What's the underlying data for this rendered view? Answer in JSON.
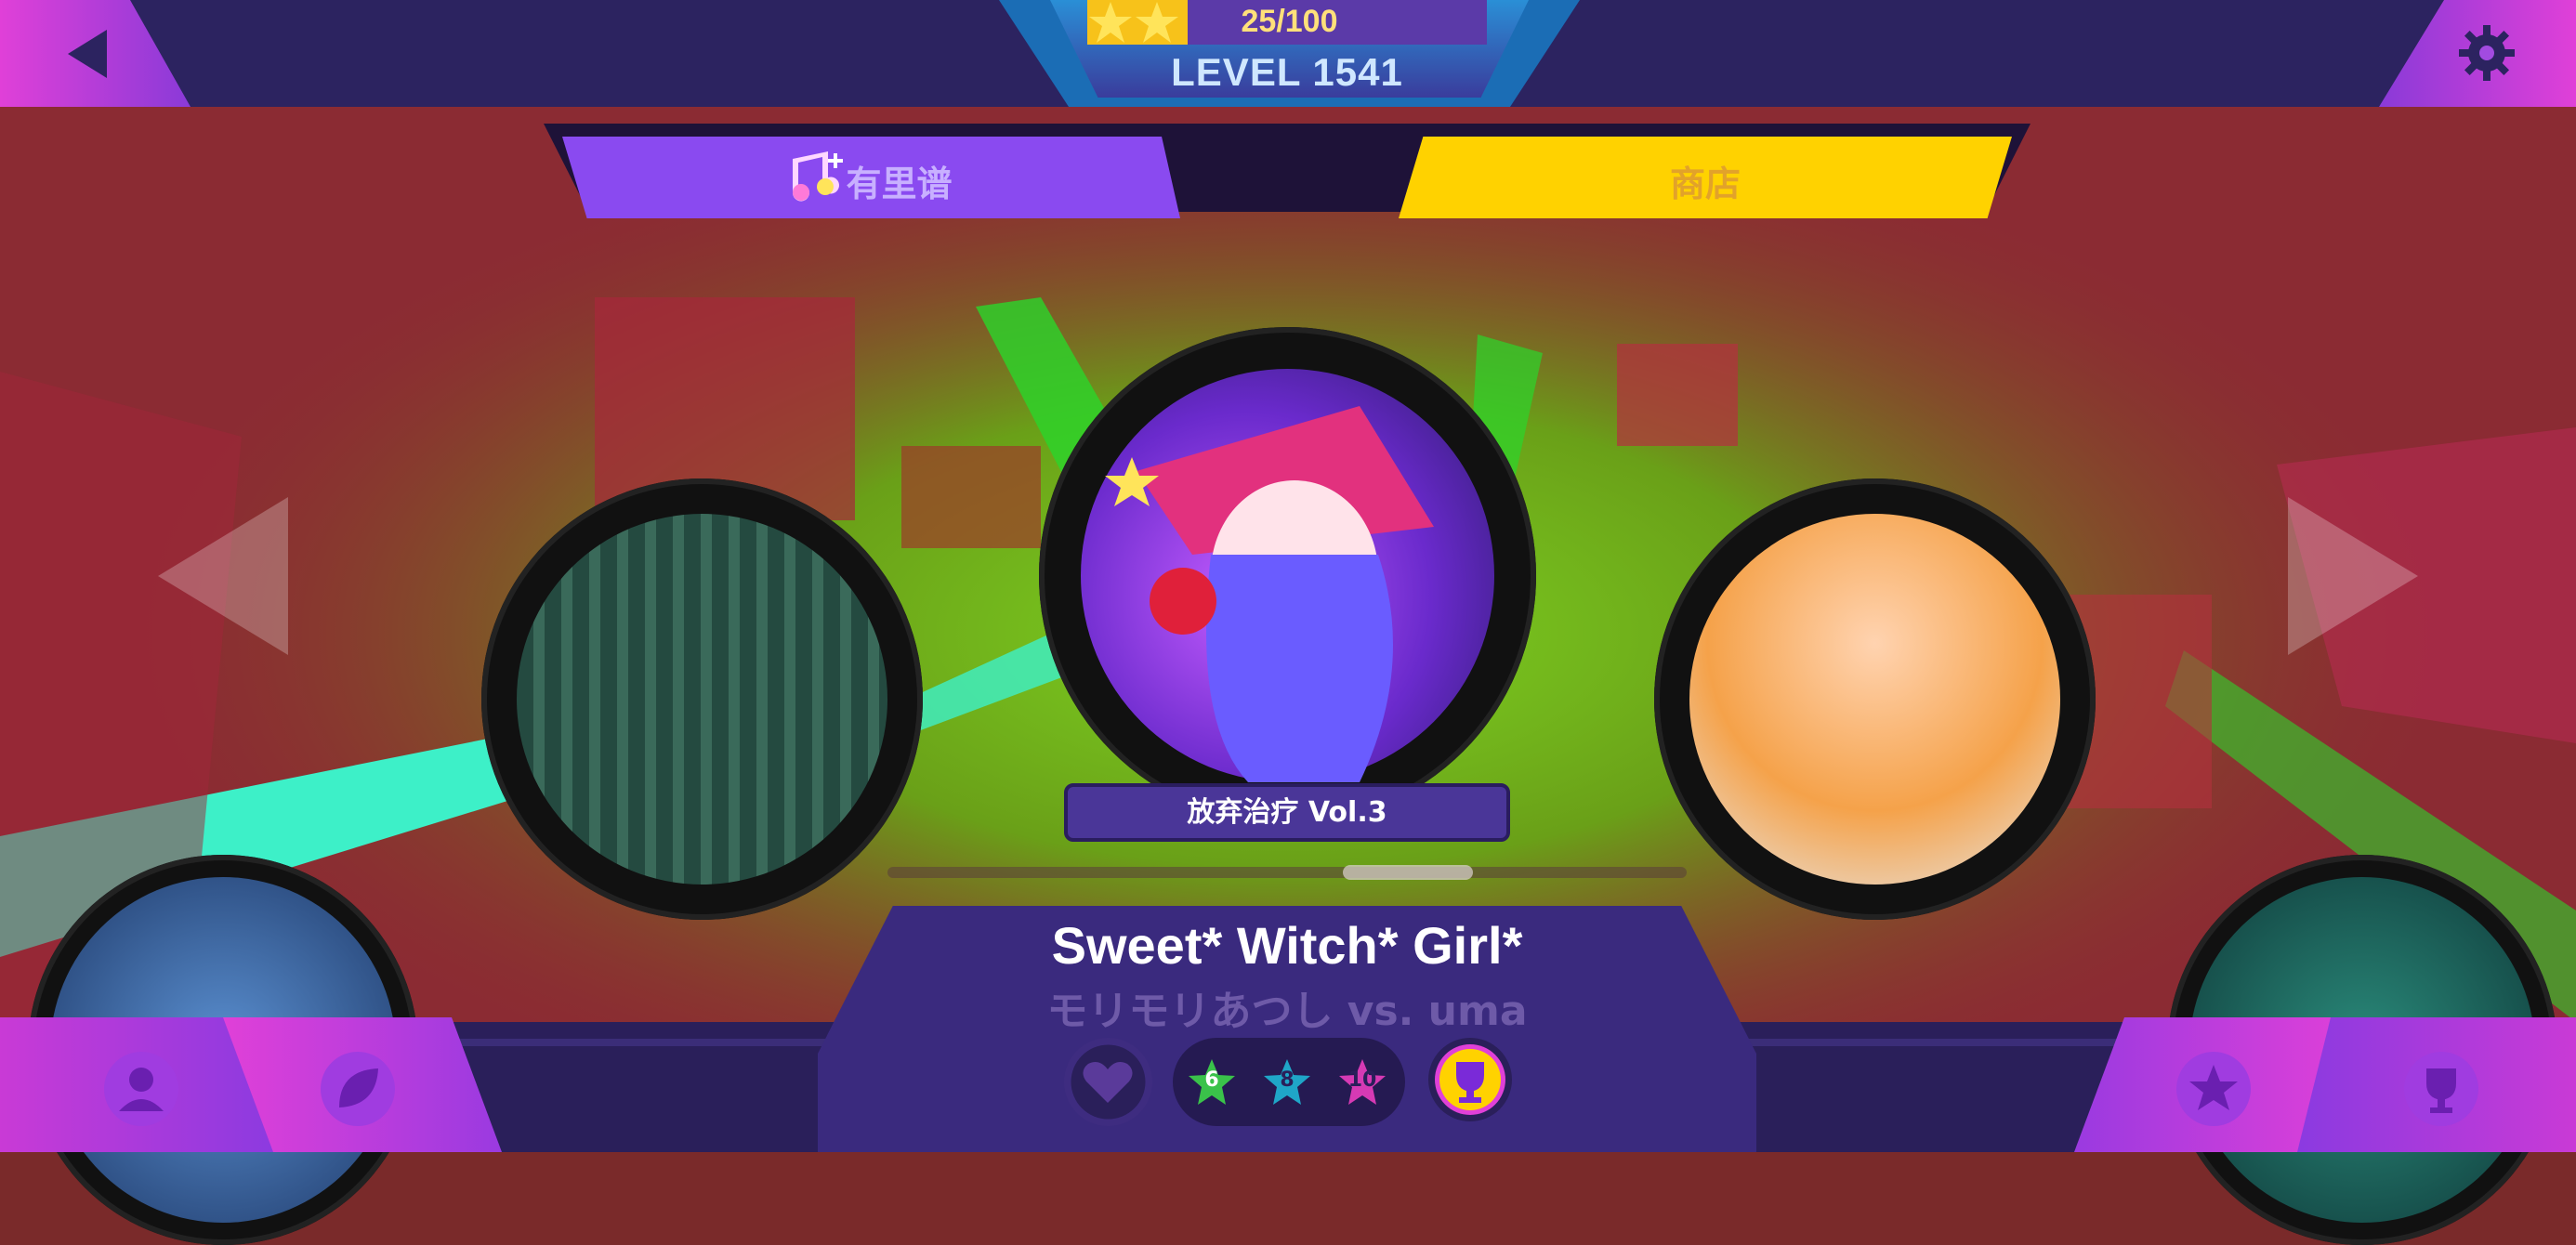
{
  "header": {
    "xp_text": "25/100",
    "xp_fraction": 0.25,
    "level_text": "LEVEL 1541"
  },
  "tabs": [
    {
      "label": "有里谱"
    },
    {
      "label": "商店"
    }
  ],
  "carousel": {
    "pack_label": "放弃治疗 Vol.3",
    "progress": 0.68
  },
  "song": {
    "title": "Sweet* Witch* Girl*",
    "artist": "モリモリあつし vs. uma"
  },
  "difficulties": [
    {
      "level": "6",
      "color": "#3ac24a"
    },
    {
      "level": "8",
      "color": "#1fa6c8"
    },
    {
      "level": "10",
      "color": "#d63ab4"
    }
  ],
  "colors": {
    "accent_purple": "#8a4af0",
    "accent_yellow": "#ffd200",
    "panel": "#3a2a7e"
  },
  "icons": [
    "back-arrow-icon",
    "gear-icon",
    "music-note-plus-icon",
    "left-arrow-icon",
    "right-arrow-icon",
    "profile-icon",
    "leaf-icon",
    "heart-icon",
    "trophy-icon",
    "star-icon",
    "cup-icon"
  ]
}
